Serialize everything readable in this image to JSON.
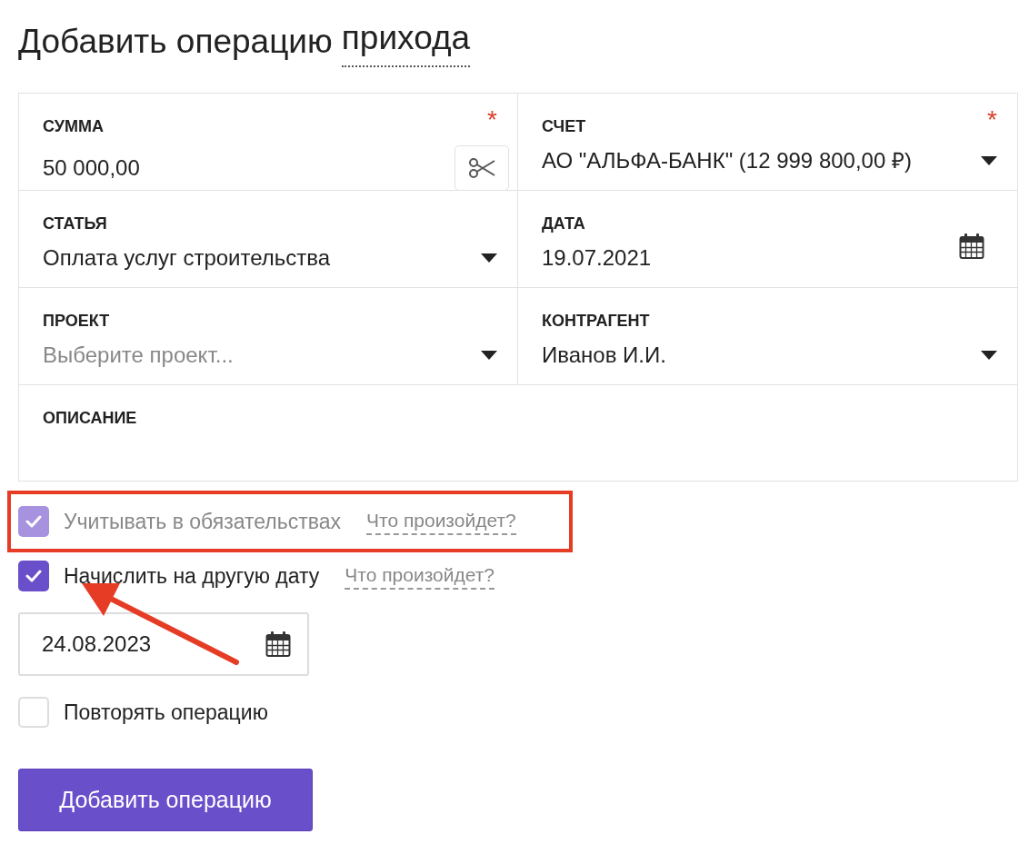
{
  "title": {
    "text": "Добавить операцию",
    "link": "прихода"
  },
  "fields": [
    {
      "kind": "amount",
      "label": "СУММА",
      "value": "50 000,00",
      "required_mark": "*"
    },
    {
      "kind": "select",
      "label": "СЧЕТ",
      "value": "АО \"АЛЬФА-БАНК\" (12 999 800,00 ₽)",
      "required_mark": "*"
    },
    {
      "kind": "select",
      "label": "СТАТЬЯ",
      "value": "Оплата услуг строительства"
    },
    {
      "kind": "date",
      "label": "ДАТА",
      "value": "19.07.2021"
    },
    {
      "kind": "select",
      "label": "ПРОЕКТ",
      "placeholder": "Выберите проект..."
    },
    {
      "kind": "select",
      "label": "КОНТРАГЕНТ",
      "value": "Иванов И.И."
    },
    {
      "kind": "textarea",
      "label": "ОПИСАНИЕ"
    }
  ],
  "options": [
    {
      "label": "Учитывать в обязательствах",
      "checked": true,
      "disabled": true,
      "help": "Что произойдет?",
      "highlighted": true,
      "pointed": false
    },
    {
      "label": "Начислить на другую дату",
      "checked": true,
      "disabled": false,
      "help": "Что произойдет?",
      "highlighted": false,
      "pointed": true,
      "date": "24.08.2023"
    },
    {
      "label": "Повторять операцию",
      "checked": false,
      "disabled": false,
      "highlighted": false,
      "pointed": false
    }
  ],
  "submit": "Добавить операцию"
}
